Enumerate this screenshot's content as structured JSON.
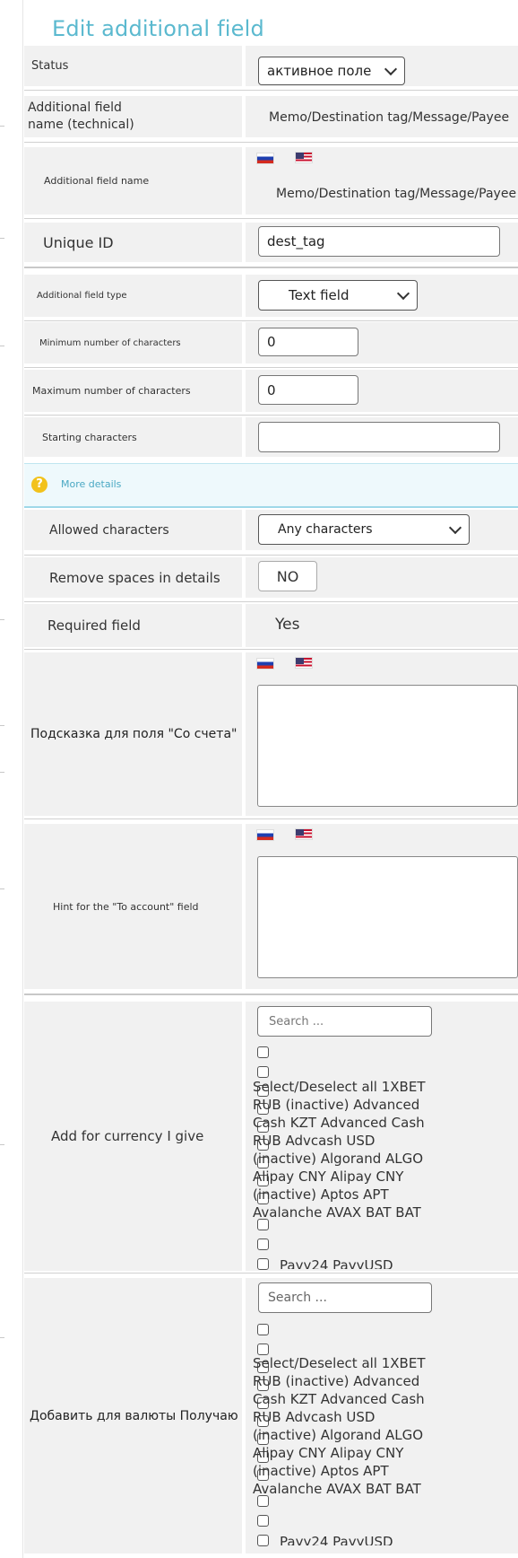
{
  "page": {
    "title": "Edit additional field"
  },
  "fields": {
    "status": {
      "label": "Status",
      "value": "активное поле"
    },
    "tech_name": {
      "label": "Additional field\nname (technical)",
      "value": "Memo/Destination tag/Message/Payee"
    },
    "field_name": {
      "label": "Additional field name",
      "value": "Memo/Destination tag/Message/Payee"
    },
    "unique_id": {
      "label": "Unique ID",
      "value": "dest_tag"
    },
    "field_type": {
      "label": "Additional field type",
      "value": "Text field"
    },
    "min_chars": {
      "label": "Minimum number of characters",
      "value": "0"
    },
    "max_chars": {
      "label": "Maximum number of characters",
      "value": "0"
    },
    "starting_chars": {
      "label": "Starting characters",
      "value": ""
    },
    "more_details": {
      "icon": "question-icon",
      "icon_glyph": "?",
      "text": "More details"
    },
    "allowed_chars": {
      "label": "Allowed characters",
      "value": "Any characters"
    },
    "remove_spaces": {
      "label": "Remove spaces in details",
      "value": "NO"
    },
    "required": {
      "label": "Required field",
      "value": "Yes"
    },
    "hint_from": {
      "label": "Подсказка для поля \"Со счета\""
    },
    "hint_to": {
      "label": "Hint for the \"To account\" field"
    },
    "currency_give": {
      "label": "Add for currency I give",
      "search_placeholder": "Search ...",
      "options_text": "Select/Deselect all 1XBET\nRUB (inactive) Advanced\nCash KZT Advanced Cash\nRUB Advcash USD\n(inactive) Algorand ALGO\nAlipay CNY Alipay CNY\n(inactive) Aptos APT\nAvalanche AVAX BAT BAT",
      "cut_text": "Payy24 PayyUSD"
    },
    "currency_get": {
      "label": "Добавить для валюты Получаю",
      "search_placeholder": "Search ...",
      "options_text": "Select/Deselect all 1XBET\nRUB (inactive) Advanced\nCash KZT Advanced Cash\nRUB Advcash USD\n(inactive) Algorand ALGO\nAlipay CNY Alipay CNY\n(inactive) Aptos APT\nAvalanche AVAX BAT BAT",
      "cut_text": "Payy24 PayyUSD"
    }
  },
  "flags": {
    "ru": "flag-russia-icon",
    "us": "flag-usa-icon"
  },
  "colors": {
    "accent": "#5bb9cf",
    "help_bg": "#eef9fc",
    "row_bg": "#f1f1f1"
  }
}
